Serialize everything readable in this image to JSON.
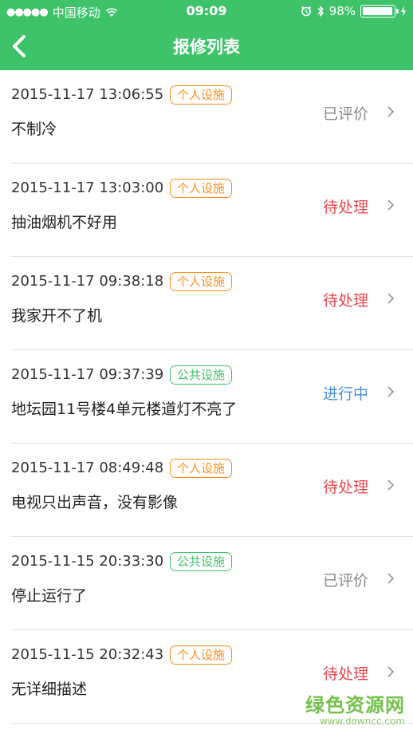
{
  "status_bar": {
    "signal": "●●●●●",
    "carrier": "中国移动",
    "time": "09:09",
    "battery": "98%",
    "battery_level": 0.98
  },
  "nav": {
    "title": "报修列表",
    "back_icon": "chevron-left-icon"
  },
  "colors": {
    "brand_green": "#3ec36b",
    "tag_personal": "#ff8c1a",
    "tag_public": "#3ec36b",
    "status_pending": "#e8484f",
    "status_in_progress": "#4a8fdb",
    "status_rated": "#888888"
  },
  "repairs": [
    {
      "time": "2015-11-17 13:06:55",
      "tag": "个人设施",
      "tag_type": "personal",
      "desc": "不制冷",
      "status": "已评价",
      "status_type": "rated"
    },
    {
      "time": "2015-11-17 13:03:00",
      "tag": "个人设施",
      "tag_type": "personal",
      "desc": "抽油烟机不好用",
      "status": "待处理",
      "status_type": "pending"
    },
    {
      "time": "2015-11-17 09:38:18",
      "tag": "个人设施",
      "tag_type": "personal",
      "desc": "我家开不了机",
      "status": "待处理",
      "status_type": "pending"
    },
    {
      "time": "2015-11-17 09:37:39",
      "tag": "公共设施",
      "tag_type": "public",
      "desc": "地坛园11号楼4单元楼道灯不亮了",
      "status": "进行中",
      "status_type": "in_progress"
    },
    {
      "time": "2015-11-17 08:49:48",
      "tag": "个人设施",
      "tag_type": "personal",
      "desc": "电视只出声音，没有影像",
      "status": "待处理",
      "status_type": "pending"
    },
    {
      "time": "2015-11-15 20:33:30",
      "tag": "公共设施",
      "tag_type": "public",
      "desc": "停止运行了",
      "status": "已评价",
      "status_type": "rated"
    },
    {
      "time": "2015-11-15 20:32:43",
      "tag": "个人设施",
      "tag_type": "personal",
      "desc": "无详细描述",
      "status": "待处理",
      "status_type": "pending"
    }
  ],
  "watermark": {
    "main": "绿色资源网",
    "sub": "www.downcc.com"
  }
}
